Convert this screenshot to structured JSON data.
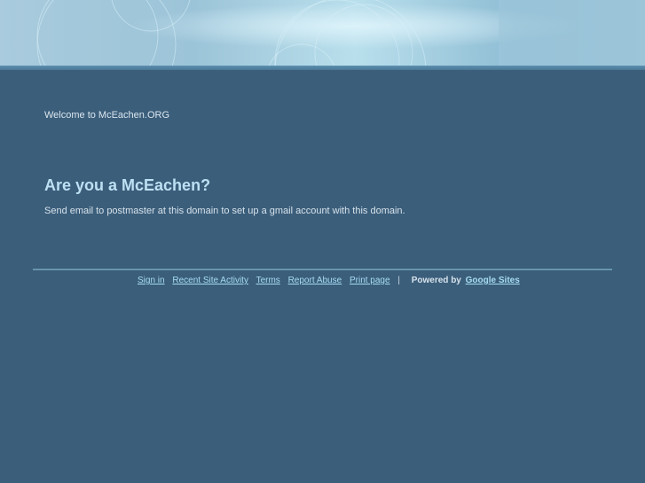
{
  "header": {
    "welcome_text": "Welcome to McEachen.ORG"
  },
  "main": {
    "headline": "Are you a McEachen?",
    "body": "Send email to postmaster at this domain to set up a gmail account with this domain."
  },
  "footer": {
    "links": [
      {
        "label": "Sign in"
      },
      {
        "label": "Recent Site Activity"
      },
      {
        "label": "Terms"
      },
      {
        "label": "Report Abuse"
      },
      {
        "label": "Print page"
      }
    ],
    "separator": "|",
    "powered_by": "Powered by",
    "brand": "Google Sites"
  },
  "colors": {
    "background": "#3b5e7b",
    "link": "#a6dcf3",
    "headline": "#bde0f3"
  }
}
